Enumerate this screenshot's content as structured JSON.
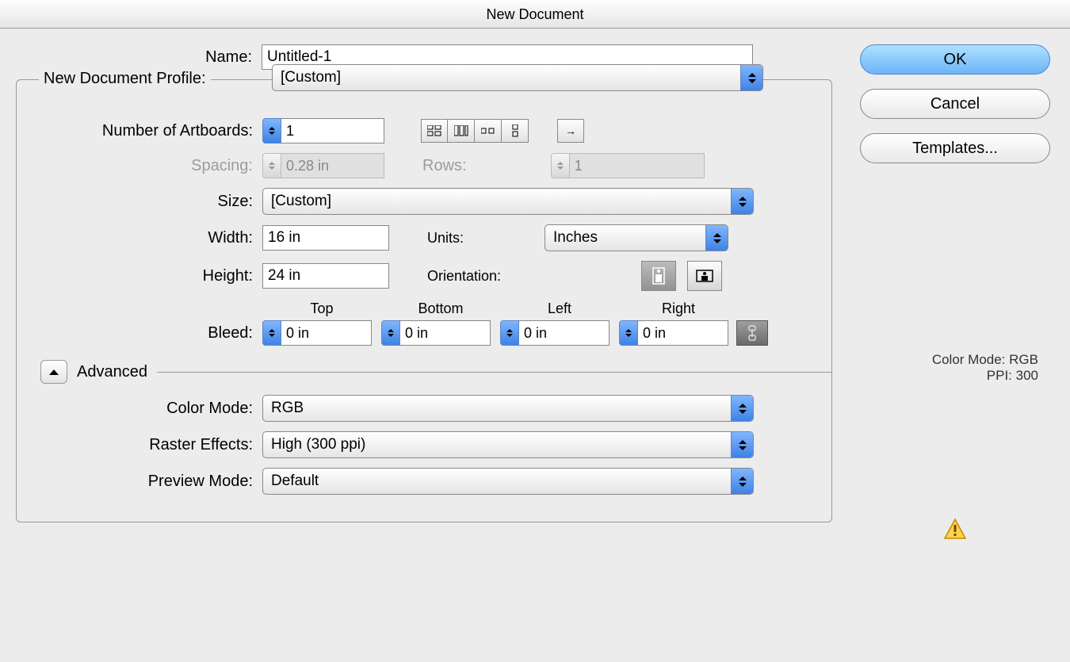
{
  "dialogTitle": "New Document",
  "nameLabel": "Name:",
  "nameValue": "Untitled-1",
  "profileLabel": "New Document Profile:",
  "profileValue": "[Custom]",
  "artboardsLabel": "Number of Artboards:",
  "artboardsValue": "1",
  "spacingLabel": "Spacing:",
  "spacingValue": "0.28 in",
  "rowsLabel": "Rows:",
  "rowsValue": "1",
  "sizeLabel": "Size:",
  "sizeValue": "[Custom]",
  "widthLabel": "Width:",
  "widthValue": "16 in",
  "unitsLabel": "Units:",
  "unitsValue": "Inches",
  "heightLabel": "Height:",
  "heightValue": "24 in",
  "orientationLabel": "Orientation:",
  "bleedLabel": "Bleed:",
  "bleed": {
    "top": "Top",
    "bottom": "Bottom",
    "left": "Left",
    "right": "Right",
    "value": "0 in"
  },
  "advancedLabel": "Advanced",
  "colorModeLabel": "Color Mode:",
  "colorModeValue": "RGB",
  "rasterLabel": "Raster Effects:",
  "rasterValue": "High (300 ppi)",
  "previewLabel": "Preview Mode:",
  "previewValue": "Default",
  "buttons": {
    "ok": "OK",
    "cancel": "Cancel",
    "templates": "Templates..."
  },
  "summary": {
    "colorModeLabel": "Color Mode:",
    "colorModeValue": "RGB",
    "ppiLabel": "PPI:",
    "ppiValue": "300"
  },
  "icons": {
    "arrowRight": "→",
    "portrait": "▯",
    "landscape": "▭",
    "link": "🔗",
    "warning": "⚠"
  }
}
